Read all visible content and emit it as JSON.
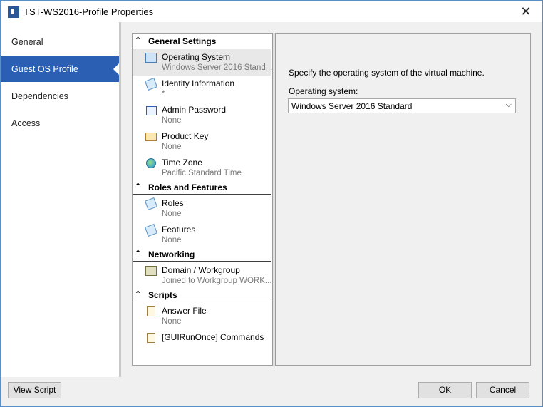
{
  "window": {
    "title": "TST-WS2016-Profile Properties",
    "close_glyph": "✕"
  },
  "nav": {
    "items": [
      {
        "label": "General"
      },
      {
        "label": "Guest OS Profile"
      },
      {
        "label": "Dependencies"
      },
      {
        "label": "Access"
      }
    ],
    "selected": "Guest OS Profile"
  },
  "settings": {
    "sections": [
      {
        "label": "General Settings",
        "items": [
          {
            "name": "Operating System",
            "value": "Windows Server 2016 Stand...",
            "icon": "operating-system-icon",
            "selected": true
          },
          {
            "name": "Identity Information",
            "value": "*",
            "icon": "identity-icon"
          },
          {
            "name": "Admin Password",
            "value": "None",
            "icon": "password-icon"
          },
          {
            "name": "Product Key",
            "value": "None",
            "icon": "product-key-icon"
          },
          {
            "name": "Time Zone",
            "value": "Pacific Standard Time",
            "icon": "globe-icon"
          }
        ]
      },
      {
        "label": "Roles and Features",
        "items": [
          {
            "name": "Roles",
            "value": "None",
            "icon": "roles-icon"
          },
          {
            "name": "Features",
            "value": "None",
            "icon": "features-icon"
          }
        ]
      },
      {
        "label": "Networking",
        "items": [
          {
            "name": "Domain / Workgroup",
            "value": "Joined to Workgroup WORK...",
            "icon": "network-icon"
          }
        ]
      },
      {
        "label": "Scripts",
        "items": [
          {
            "name": "Answer File",
            "value": "None",
            "icon": "answer-file-icon"
          },
          {
            "name": "[GUIRunOnce] Commands",
            "value": "",
            "icon": "commands-icon"
          }
        ]
      }
    ]
  },
  "detail": {
    "description": "Specify the operating system of the virtual machine.",
    "os_label": "Operating system:",
    "os_value": "Windows Server 2016 Standard"
  },
  "footer": {
    "view_script": "View Script",
    "ok": "OK",
    "cancel": "Cancel"
  },
  "colors": {
    "accent": "#2b5fb4",
    "dialog_bg": "#f0f0f0",
    "border": "#5b8fc7"
  }
}
